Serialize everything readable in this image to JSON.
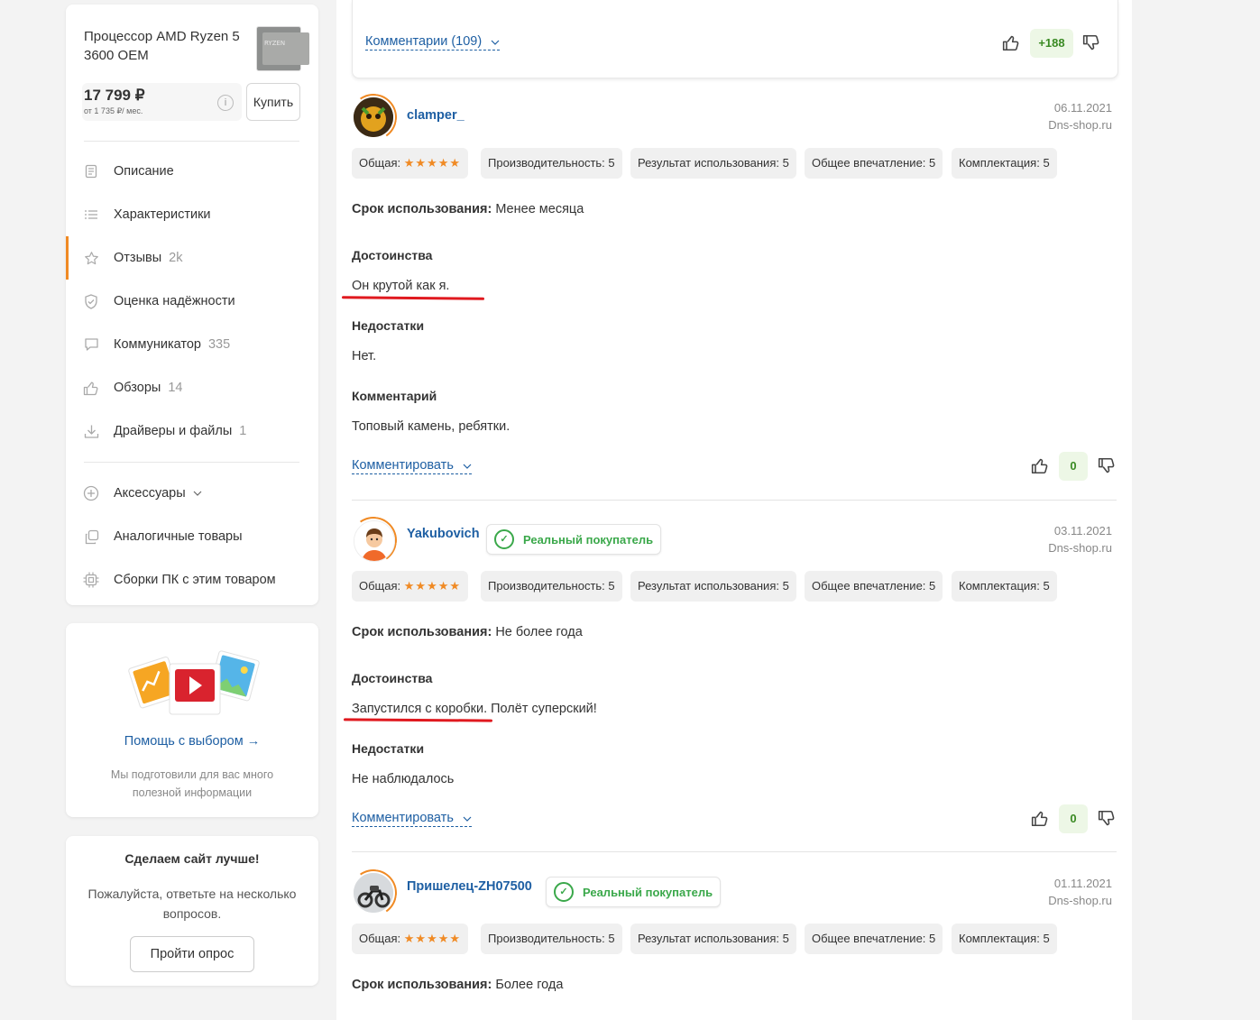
{
  "sidebar": {
    "product": {
      "title": "Процессор AMD Ryzen 5 3600 OEM",
      "thumb_text": "RYZEN",
      "price": "17 799 ₽",
      "installment": "от 1 735 ₽/ мес.",
      "buy_label": "Купить"
    },
    "nav": [
      {
        "label": "Описание",
        "count": "",
        "icon": "document-icon"
      },
      {
        "label": "Характеристики",
        "count": "",
        "icon": "list-icon"
      },
      {
        "label": "Отзывы",
        "count": "2k",
        "icon": "star-icon"
      },
      {
        "label": "Оценка надёжности",
        "count": "",
        "icon": "shield-icon"
      },
      {
        "label": "Коммуникатор",
        "count": "335",
        "icon": "chat-icon"
      },
      {
        "label": "Обзоры",
        "count": "14",
        "icon": "thumb-up-icon"
      },
      {
        "label": "Драйверы и файлы",
        "count": "1",
        "icon": "download-icon"
      }
    ],
    "nav2": [
      {
        "label": "Аксессуары",
        "icon": "plus-circle-icon"
      },
      {
        "label": "Аналогичные товары",
        "icon": "copy-icon"
      },
      {
        "label": "Сборки ПК с этим товаром",
        "icon": "cpu-icon"
      }
    ],
    "promo": {
      "link": "Помощь с выбором →",
      "text": "Мы подготовили для вас много полезной информации"
    },
    "survey": {
      "title": "Сделаем сайт лучше!",
      "text": "Пожалуйста, ответьте на несколько вопросов.",
      "button": "Пройти опрос"
    }
  },
  "prev_review": {
    "comments_link": "Комментарии (109)",
    "rating": "+188"
  },
  "ratings_labels": {
    "overall": "Общая:",
    "performance": "Производительность: 5",
    "usage": "Результат использования: 5",
    "impression": "Общее впечатление: 5",
    "kit": "Комплектация: 5"
  },
  "labels": {
    "usage_term": "Срок использования:",
    "pros": "Достоинства",
    "cons": "Недостатки",
    "comment": "Комментарий",
    "reply": "Комментировать",
    "real_buyer": "Реальный покупатель"
  },
  "reviews": [
    {
      "user": "clamper_",
      "date": "06.11.2021",
      "source": "Dns-shop.ru",
      "usage_term": "Менее месяца",
      "pros": "Он крутой как я.",
      "cons": "Нет.",
      "comment": "Топовый камень, ребятки.",
      "rating": "0"
    },
    {
      "user": "Yakubovich",
      "date": "03.11.2021",
      "source": "Dns-shop.ru",
      "usage_term": "Не более года",
      "pros": "Запустился с коробки.",
      "pros_rest": " Полёт суперский!",
      "cons": "Не наблюдалось",
      "rating": "0"
    },
    {
      "user": "Пришелец-ZH07500",
      "date": "01.11.2021",
      "source": "Dns-shop.ru",
      "usage_term": "Более года"
    }
  ]
}
